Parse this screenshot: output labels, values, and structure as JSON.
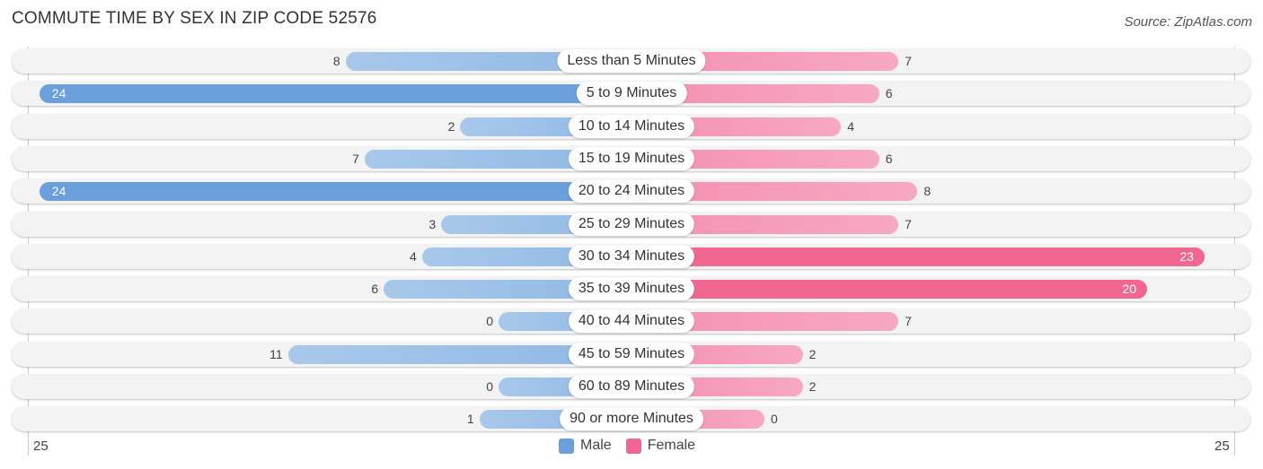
{
  "chart_data": {
    "type": "bar",
    "orientation": "horizontal-diverging",
    "title": "COMMUTE TIME BY SEX IN ZIP CODE 52576",
    "source": "Source: ZipAtlas.com",
    "categories": [
      "Less than 5 Minutes",
      "5 to 9 Minutes",
      "10 to 14 Minutes",
      "15 to 19 Minutes",
      "20 to 24 Minutes",
      "25 to 29 Minutes",
      "30 to 34 Minutes",
      "35 to 39 Minutes",
      "40 to 44 Minutes",
      "45 to 59 Minutes",
      "60 to 89 Minutes",
      "90 or more Minutes"
    ],
    "series": [
      {
        "name": "Male",
        "color": "#6a9fdc",
        "color_light": "#a8c8ea",
        "values": [
          8,
          24,
          2,
          7,
          24,
          3,
          4,
          6,
          0,
          11,
          0,
          1
        ]
      },
      {
        "name": "Female",
        "color": "#f06792",
        "color_light": "#f7a8c2",
        "values": [
          7,
          6,
          4,
          6,
          8,
          7,
          23,
          20,
          7,
          2,
          2,
          0
        ]
      }
    ],
    "axis": {
      "left_label": "25",
      "right_label": "25",
      "max": 25
    },
    "legend": {
      "position": "bottom-center",
      "items": [
        "Male",
        "Female"
      ]
    }
  }
}
